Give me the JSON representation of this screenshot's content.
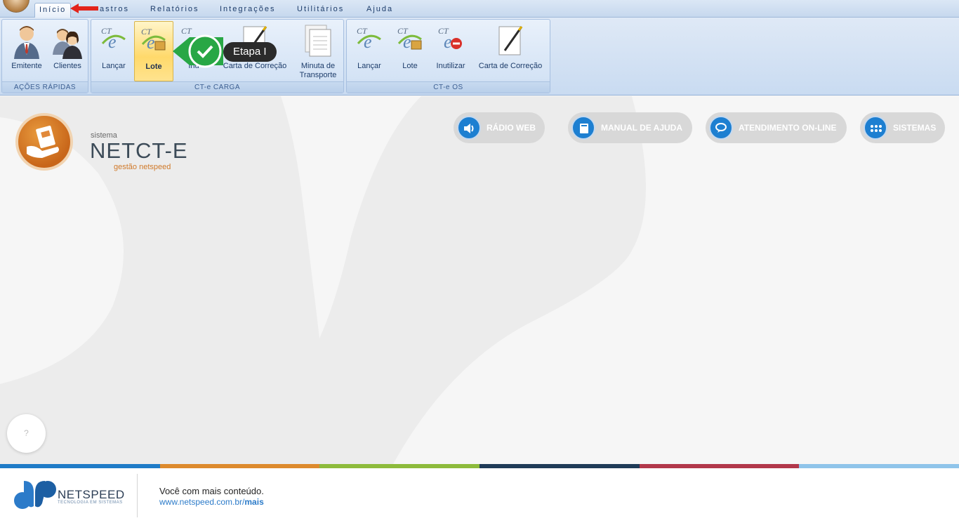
{
  "tabs": [
    "Início",
    "Cadastros",
    "Relatórios",
    "Integrações",
    "Utilitários",
    "Ajuda"
  ],
  "tabs_visible": {
    "inicio": "Início",
    "cadastros": "astros",
    "relatorios": "Relatórios",
    "integracoes": "Integrações",
    "utilitarios": "Utilitários",
    "ajuda": "Ajuda"
  },
  "ribbon": {
    "acoes": {
      "label": "AÇÕES RÁPIDAS",
      "emitente": "Emitente",
      "clientes": "Clientes"
    },
    "carga": {
      "label": "CT-e CARGA",
      "lancar": "Lançar",
      "lote": "Lote",
      "inutilizar": "Inu",
      "carta": "Carta de Correção",
      "minuta_1": "Minuta de",
      "minuta_2": "Transporte"
    },
    "os": {
      "label": "CT-e OS",
      "lancar": "Lançar",
      "lote": "Lote",
      "inutilizar": "Inutilizar",
      "carta": "Carta de Correção"
    }
  },
  "tooltip": {
    "label": "Etapa I"
  },
  "brand": {
    "small": "sistema",
    "name": "NETCT-E",
    "sub": "gestão netspeed"
  },
  "pills": {
    "radio": "RÁDIO WEB",
    "manual": "MANUAL DE AJUDA",
    "atendimento": "ATENDIMENTO ON-LINE",
    "sistemas": "SISTEMAS"
  },
  "help": {
    "label": "?"
  },
  "footer": {
    "company": "NETSPEED",
    "tagline": "TECNOLOGIA EM SISTEMAS",
    "text": "Você com mais conteúdo.",
    "link_base": "www.netspeed.com.br/",
    "link_bold": "mais"
  },
  "colors": {
    "stripe": [
      "#1f7bc7",
      "#dd8a2d",
      "#8dbb3c",
      "#1f3b57",
      "#b2384b",
      "#8fc4ea"
    ],
    "accent": "#1d7fd1"
  }
}
